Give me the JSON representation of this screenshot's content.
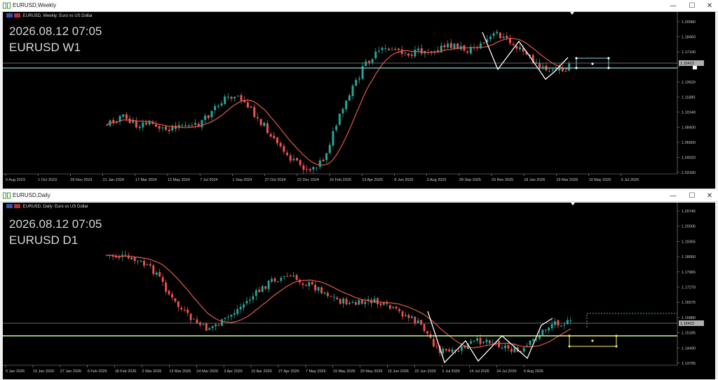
{
  "window1": {
    "title": "EURUSD,Weekly",
    "header": "EURUSD, Weekly: Euro vs US Dollar",
    "datetime": "2026.08.12 07:05",
    "symbol_tf": "EURUSD W1",
    "price_labels": [
      "1.20580",
      "1.18460",
      "1.17100",
      "1.15422",
      "1.13620",
      "1.11880",
      "1.10140",
      "1.08400",
      "1.06660",
      "1.04920",
      "1.03180"
    ],
    "date_labels": [
      "6 Aug 2023",
      "1 Oct 2023",
      "26 Nov 2023",
      "21 Jan 2024",
      "17 Mar 2024",
      "12 May 2024",
      "7 Jul 2024",
      "1 Sep 2024",
      "27 Oct 2024",
      "22 Dec 2024",
      "16 Feb 2025",
      "13 Apr 2025",
      "8 Jun 2025",
      "3 Aug 2025",
      "28 Sep 2025",
      "23 Nov 2025",
      "18 Jan 2026",
      "15 Mar 2026",
      "10 May 2026",
      "5 Jul 2026"
    ],
    "current_price": "1.15422"
  },
  "window2": {
    "title": "EURUSD,Daily",
    "header": "EURUSD, Daily: Euro vs US Dollar",
    "datetime": "2026.08.12 07:05",
    "symbol_tf": "EURUSD D1",
    "price_labels": [
      "1.20745",
      "1.20005",
      "1.19355",
      "1.18660",
      "1.17965",
      "1.17270",
      "1.16575",
      "1.15880",
      "1.15185",
      "1.14490",
      "1.13795"
    ],
    "date_labels": [
      "5 Jan 2026",
      "15 Jan 2026",
      "27 Jan 2026",
      "6 Feb 2026",
      "18 Feb 2026",
      "2 Mar 2026",
      "12 Mar 2026",
      "24 Mar 2026",
      "3 Apr 2026",
      "15 Apr 2026",
      "27 Apr 2026",
      "7 May 2026",
      "19 May 2026",
      "29 May 2026",
      "10 Jun 2026",
      "22 Jun 2026",
      "2 Jul 2026",
      "14 Jul 2026",
      "24 Jul 2026",
      "5 Aug 2026"
    ],
    "current_price": "1.15422"
  },
  "controls": {
    "minimize": "—",
    "maximize": "☐",
    "close": "✕"
  },
  "colors": {
    "bull": "#26a69a",
    "bear": "#ef5350",
    "ma": "#e05a45",
    "hline": "#7fd8d8",
    "zigzag": "#ffffff",
    "box": "#f0e060",
    "greenline": "#c8ff80"
  }
}
